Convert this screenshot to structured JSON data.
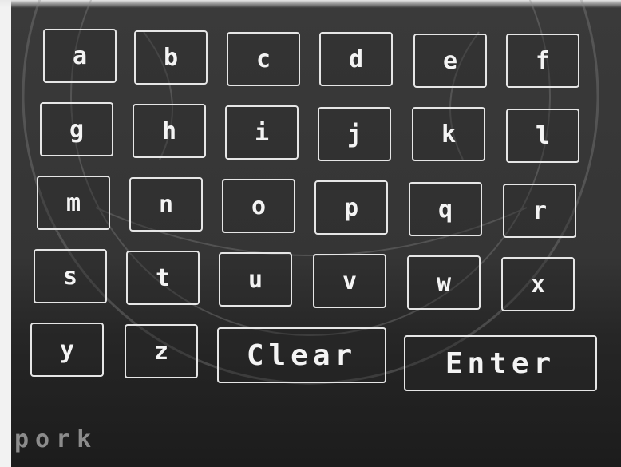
{
  "keyboard": {
    "keys": {
      "a": "a",
      "b": "b",
      "c": "c",
      "d": "d",
      "e": "e",
      "f": "f",
      "g": "g",
      "h": "h",
      "i": "i",
      "j": "j",
      "k": "k",
      "l": "l",
      "m": "m",
      "n": "n",
      "o": "o",
      "p": "p",
      "q": "q",
      "r": "r",
      "s": "s",
      "t": "t",
      "u": "u",
      "v": "v",
      "w": "w",
      "x": "x",
      "y": "y",
      "z": "z"
    },
    "clear_label": "Clear",
    "enter_label": "Enter"
  },
  "input": {
    "value": "pork"
  },
  "colors": {
    "key_border": "#e6e6e6",
    "key_text": "#f4f4f4",
    "background": "#353535",
    "input_text": "#8c8c8c"
  }
}
